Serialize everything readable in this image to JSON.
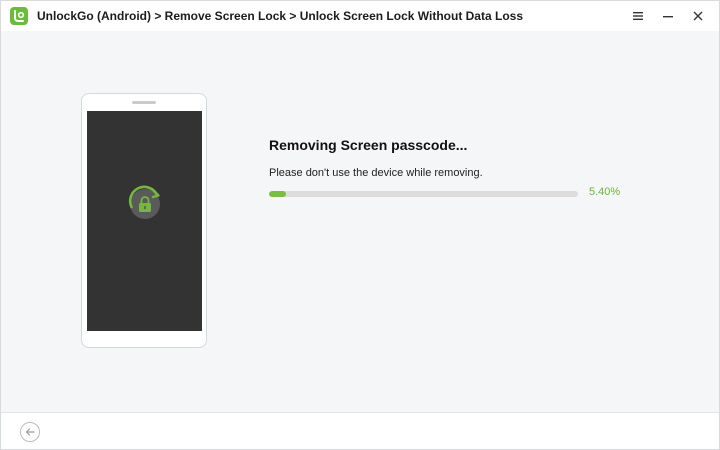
{
  "window": {
    "title": "UnlockGo (Android) > Remove Screen Lock > Unlock Screen Lock Without Data Loss",
    "controls": {
      "menu_icon": "menu-icon",
      "minimize_icon": "minimize-icon",
      "close_icon": "close-icon"
    }
  },
  "device": {
    "screen_icon": "lock-refresh-icon"
  },
  "status": {
    "title": "Removing Screen passcode...",
    "subtitle": "Please don't use the device while removing.",
    "progress_percent": 5.4,
    "progress_label": "5.40%"
  },
  "footer": {
    "back_icon": "back-arrow-icon"
  },
  "colors": {
    "accent": "#79be43",
    "percent_text": "#6db33f",
    "screen": "#333333",
    "background": "#f5f6f8"
  }
}
